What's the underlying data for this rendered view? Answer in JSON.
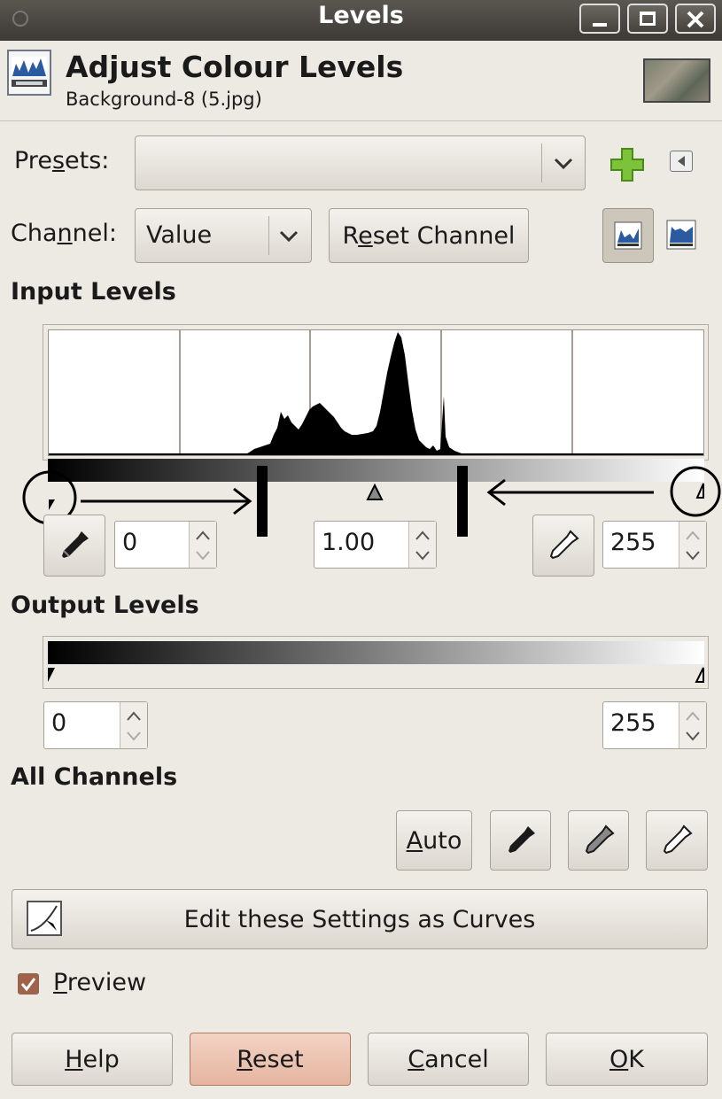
{
  "window": {
    "title": "Levels"
  },
  "header": {
    "title": "Adjust Colour Levels",
    "subtitle": "Background-8 (5.jpg)"
  },
  "presets": {
    "label": "Presets:",
    "value": ""
  },
  "channel": {
    "label": "Channel:",
    "value": "Value",
    "reset_label": "Reset Channel"
  },
  "input_levels": {
    "heading": "Input Levels",
    "low": "0",
    "gamma": "1.00",
    "high": "255"
  },
  "output_levels": {
    "heading": "Output Levels",
    "low": "0",
    "high": "255"
  },
  "all_channels": {
    "heading": "All Channels",
    "auto_label": "Auto"
  },
  "curves_button": {
    "label": "Edit these Settings as Curves"
  },
  "preview": {
    "label": "Preview",
    "checked": true
  },
  "buttons": {
    "help": "Help",
    "reset": "Reset",
    "cancel": "Cancel",
    "ok": "OK"
  },
  "icons": [
    "histogram-icon",
    "add-preset-icon",
    "menu-arrow-icon",
    "linear-histogram-icon",
    "log-histogram-icon",
    "eyedropper-icon",
    "curves-icon",
    "minimize-icon",
    "maximize-icon",
    "close-icon"
  ]
}
